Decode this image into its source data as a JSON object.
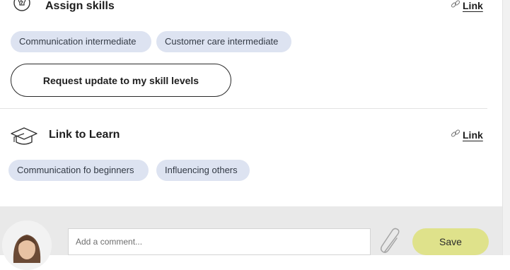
{
  "assign_skills": {
    "title": "Assign skills",
    "link_label": "Link",
    "chips": [
      "Communication intermediate",
      "Customer care intermediate"
    ],
    "request_button_label": "Request update to my skill levels"
  },
  "link_to_learn": {
    "title": "Link to Learn",
    "link_label": "Link",
    "chips": [
      "Communication fo beginners",
      "Influencing others"
    ]
  },
  "comment": {
    "placeholder": "Add a comment...",
    "save_label": "Save"
  },
  "colors": {
    "chip_bg": "#dde3f1",
    "save_bg": "#dfe28b",
    "footer_bg": "#e9e9e9"
  },
  "icons": [
    "lightbulb-icon",
    "link-icon",
    "graduation-cap-icon",
    "paperclip-icon"
  ]
}
